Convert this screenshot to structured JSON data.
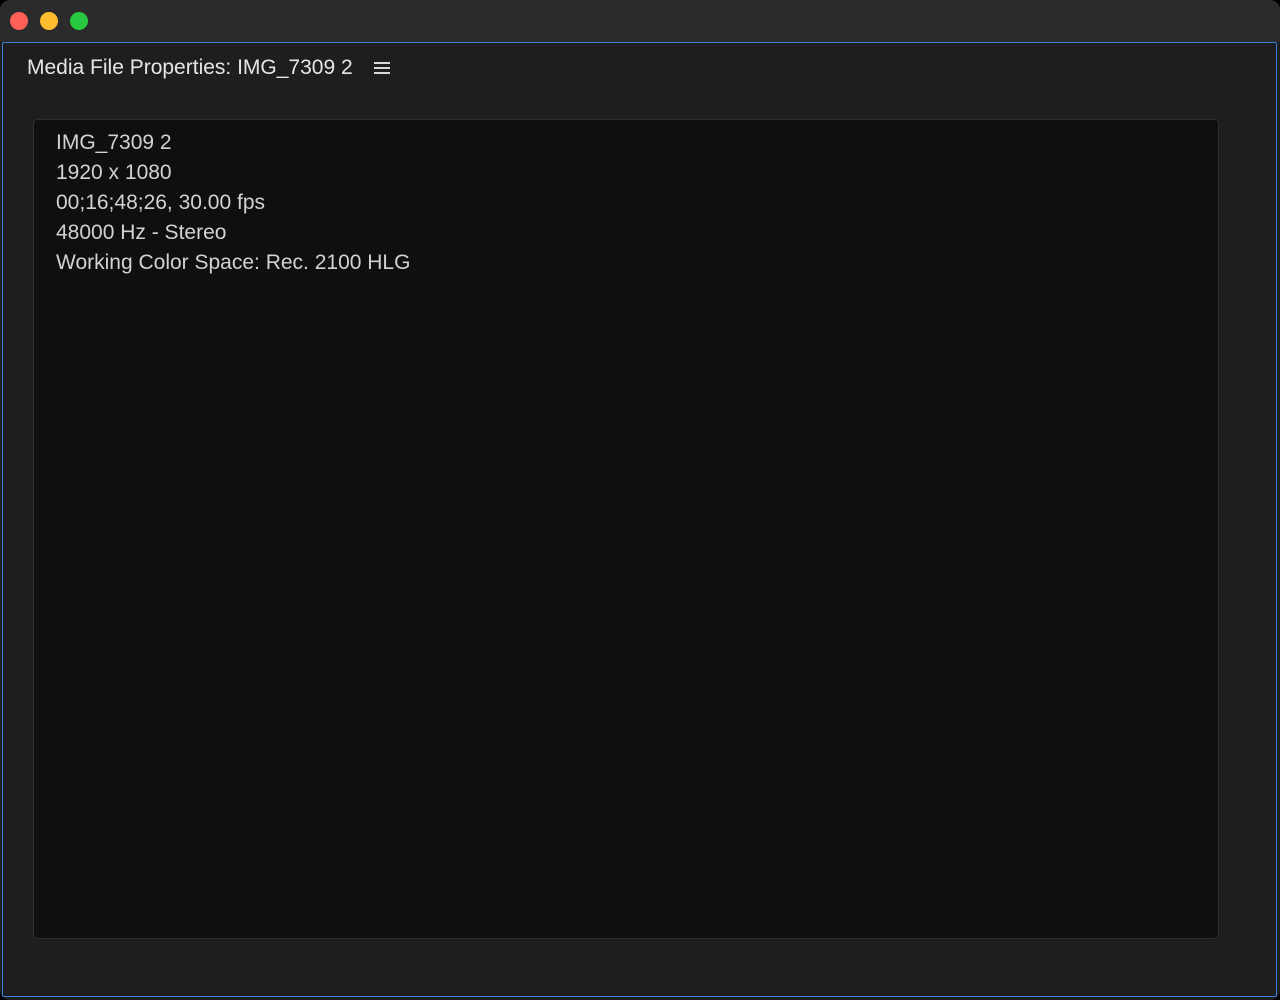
{
  "window": {
    "traffic_lights": {
      "close_color": "#ff5f57",
      "minimize_color": "#febc2e",
      "zoom_color": "#28c840"
    }
  },
  "panel": {
    "title": "Media File Properties: IMG_7309 2",
    "menu_icon": "hamburger-menu-icon",
    "accent_color": "#3d7fd6"
  },
  "properties": {
    "lines": [
      "IMG_7309 2",
      "1920 x 1080",
      "00;16;48;26, 30.00 fps",
      "48000 Hz - Stereo",
      "Working Color Space: Rec. 2100 HLG"
    ]
  }
}
